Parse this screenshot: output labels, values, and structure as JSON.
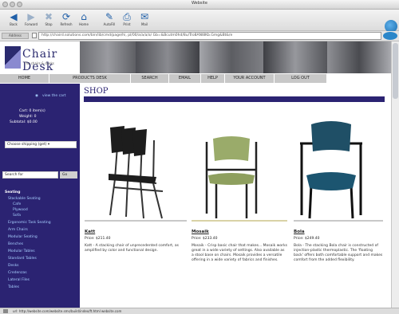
{
  "window": {
    "title": "Website"
  },
  "toolbar": {
    "buttons": [
      {
        "label": "Back",
        "icon": "back-arrow-icon"
      },
      {
        "label": "Forward",
        "icon": "forward-arrow-icon"
      },
      {
        "label": "Stop",
        "icon": "stop-icon"
      },
      {
        "label": "Refresh",
        "icon": "refresh-icon"
      },
      {
        "label": "Home",
        "icon": "home-icon"
      },
      {
        "label": "AutoFill",
        "icon": "autofill-icon"
      },
      {
        "label": "Print",
        "icon": "print-icon"
      },
      {
        "label": "Mail",
        "icon": "mail-icon"
      }
    ]
  },
  "address_bar": {
    "label": "Address",
    "url": "http://chaird.solutions.com/bin/lib/cmd/page/hi, pl/00/a/a/a/a/ Gb=&Bcutm0hd/8u/Tro8ANl8Kb.Gmg&Bt&/e"
  },
  "header": {
    "logo_text": "Chair Desk",
    "logo_subtitle": "The chairs & desks"
  },
  "nav": {
    "items": [
      "Home",
      "Products Desk",
      "Search",
      "Email",
      "Help",
      "Your Account",
      "Log Out"
    ]
  },
  "sidebar": {
    "cart_link": "view the cart",
    "cart_items_label": "Cart: 0 item(s)",
    "cart_weight_label": "Weight: 0",
    "subtotal_label": "Subtotal: $0.00",
    "shipping_select": "Choose shipping (get) ▾",
    "search_placeholder": "Search for",
    "search_button": "Go",
    "category_header": "Seating",
    "categories": [
      "Stackable Seating",
      "Cafe",
      "Plywood",
      "Sofa",
      "Ergonomic Task Seating",
      "Arm Chairs",
      "Modular Seating",
      "Benches",
      "Modular Tables",
      "Standard Tables",
      "Desks",
      "Credenzas",
      "Lateral Files",
      "Tables"
    ]
  },
  "main": {
    "title": "SHOP",
    "products": [
      {
        "name": "Katt",
        "price": "Price: $211.40",
        "description": "Katt - A stacking chair of unprecedented comfort, as amplified by color and functional design."
      },
      {
        "name": "Mosaik",
        "price": "Price: $233.40",
        "description": "Mosaik - Crisp basic chair that makes... Mosaik works great in a wide variety of settings. Also available as a stool base on chairs. Mosaik provides a versatile offering in a wide variety of fabrics and finishes."
      },
      {
        "name": "Bola",
        "price": "Price: $249.40",
        "description": "Bola - The stacking Bola chair is constructed of injection-plastic thermoplastic. The 'floating back' offers both comfortable support and makes comfort from the added flexibility."
      }
    ]
  },
  "status_bar": {
    "text": "url: http://website.com/website.sms/build/index/ft.html website.com"
  },
  "colors": {
    "brand_navy": "#2b2372",
    "link_blue": "#a8d0ff",
    "nav_gray": "#c8c8c8"
  }
}
